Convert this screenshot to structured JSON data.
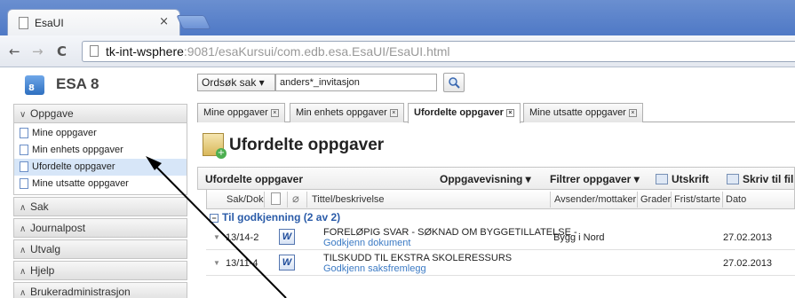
{
  "browser": {
    "tab_title": "EsaUI",
    "tab_close": "×",
    "url_host": "tk-int-wsphere",
    "url_rest": ":9081/esaKursui/com.edb.esa.EsaUI/EsaUI.html",
    "back": "←",
    "forward": "→",
    "reload": "C"
  },
  "app": {
    "logo_num": "8",
    "name": "ESA 8"
  },
  "search": {
    "mode": "Ordsøk sak",
    "value": "anders*_invitasjon"
  },
  "sidebar": {
    "sections": [
      {
        "label": "Oppgave",
        "expanded": true
      },
      {
        "label": "Sak"
      },
      {
        "label": "Journalpost"
      },
      {
        "label": "Utvalg"
      },
      {
        "label": "Hjelp"
      },
      {
        "label": "Brukeradministrasjon"
      }
    ],
    "items": [
      {
        "label": "Mine oppgaver"
      },
      {
        "label": "Min enhets oppgaver"
      },
      {
        "label": "Ufordelte oppgaver",
        "selected": true
      },
      {
        "label": "Mine utsatte oppgaver"
      }
    ]
  },
  "tabs": [
    {
      "label": "Mine oppgaver"
    },
    {
      "label": "Min enhets oppgaver"
    },
    {
      "label": "Ufordelte oppgaver",
      "active": true
    },
    {
      "label": "Mine utsatte oppgaver"
    }
  ],
  "page": {
    "title": "Ufordelte oppgaver"
  },
  "grid": {
    "title": "Ufordelte oppgaver",
    "actions": {
      "view": "Oppgavevisning ▾",
      "filter": "Filtrer oppgaver ▾",
      "print": "Utskrift",
      "write": "Skriv til fil"
    },
    "columns": {
      "sakdok": "Sak/Dok",
      "title": "Tittel/beskrivelse",
      "sender": "Avsender/mottaker",
      "grader": "Grader",
      "frist": "Frist/starte fø",
      "dato": "Dato"
    },
    "group": {
      "label": "Til godkjenning (2 av 2)",
      "toggle": "−"
    },
    "rows": [
      {
        "sakdok": "13/14-2",
        "title": "FORELØPIG SVAR - SØKNAD OM BYGGETILLATELSE -",
        "subtitle": "Godkjenn dokument",
        "sender": "Bygg i Nord",
        "date": "27.02.2013"
      },
      {
        "sakdok": "13/11-4",
        "title": "TILSKUDD TIL EKSTRA SKOLERESSURS",
        "subtitle": "Godkjenn saksfremlegg",
        "sender": "",
        "date": "27.02.2013"
      }
    ]
  },
  "colors": {
    "selected_row": "#d7e6f8",
    "group_text": "#2a5ba8",
    "link_text": "#3b7ac4"
  }
}
